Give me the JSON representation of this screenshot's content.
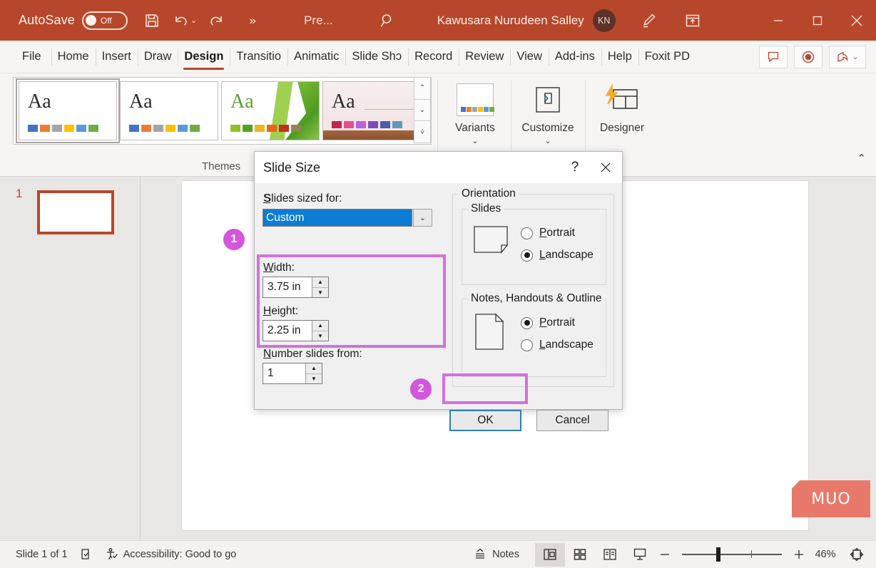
{
  "titlebar": {
    "autosave_label": "AutoSave",
    "autosave_state": "Off",
    "save_icon": "save-icon",
    "undo_icon": "undo-icon",
    "redo_icon": "redo-icon",
    "more_icon": "chevron-double-right-icon",
    "filename": "Pre...",
    "search_icon": "search-icon",
    "username": "Kawusara Nurudeen Salley",
    "avatar_initials": "KN",
    "pen_icon": "pen-draw-icon",
    "ribbon_display_icon": "ribbon-display-options-icon",
    "minimize": "minimize-icon",
    "maximize": "maximize-icon",
    "close": "close-icon",
    "bg_color": "#b7472a"
  },
  "tabs": [
    {
      "label": "File",
      "active": false
    },
    {
      "label": "Home",
      "active": false
    },
    {
      "label": "Insert",
      "active": false
    },
    {
      "label": "Draw",
      "active": false
    },
    {
      "label": "Design",
      "active": true
    },
    {
      "label": "Transitio",
      "active": false
    },
    {
      "label": "Animatic",
      "active": false
    },
    {
      "label": "Slide Shɔ",
      "active": false
    },
    {
      "label": "Record",
      "active": false
    },
    {
      "label": "Review",
      "active": false
    },
    {
      "label": "View",
      "active": false
    },
    {
      "label": "Add-ins",
      "active": false
    },
    {
      "label": "Help",
      "active": false
    },
    {
      "label": "Foxit PD",
      "active": false
    }
  ],
  "tabbar_right": [
    {
      "name": "comments-button",
      "icon": "comment-icon"
    },
    {
      "name": "record-button",
      "icon": "record-circle-icon"
    },
    {
      "name": "share-button",
      "icon": "share-icon"
    }
  ],
  "ribbon": {
    "themes_group_label": "Themes",
    "themes": [
      {
        "name": "office-theme",
        "aa": "Aa",
        "selected": true,
        "swatches": [
          "#4472c4",
          "#ed7d31",
          "#a5a5a5",
          "#ffc000",
          "#5b9bd5",
          "#70ad47"
        ]
      },
      {
        "name": "office-theme-2",
        "aa": "Aa",
        "selected": false,
        "swatches": [
          "#4472c4",
          "#ed7d31",
          "#a5a5a5",
          "#ffc000",
          "#5b9bd5",
          "#70ad47"
        ]
      },
      {
        "name": "facet-theme",
        "aa": "Aa",
        "selected": false,
        "swatches": [
          "#90c226",
          "#54a021",
          "#e6b91e",
          "#e76618",
          "#c42f1a",
          "#918655"
        ]
      },
      {
        "name": "wisp-theme",
        "aa": "Aa",
        "selected": false,
        "swatches": [
          "#c0264a",
          "#e0518e",
          "#b861d9",
          "#7c4bb5",
          "#4a5db0",
          "#5f9ab5"
        ]
      }
    ],
    "gallery_scroll": [
      "scroll-up-icon",
      "scroll-down-icon",
      "more-themes-icon"
    ],
    "variants": {
      "label": "Variants",
      "caret": "chevron-down-icon"
    },
    "customize": {
      "label": "Customize",
      "caret": "chevron-down-icon"
    },
    "designer": {
      "label": "Designer"
    },
    "collapse_icon": "chevron-up-icon"
  },
  "thumbnail_pane": {
    "slide_number": "1"
  },
  "watermark": {
    "text": "MUO",
    "color": "#e8796a"
  },
  "dialog": {
    "title": "Slide Size",
    "help_icon": "help-question-icon",
    "close_icon": "close-icon",
    "sized_for_label": "Slides sized for:",
    "sized_for_value": "Custom",
    "dropdown_icon": "chevron-down-icon",
    "width_label": "Width:",
    "width_value": "3.75 in",
    "height_label": "Height:",
    "height_value": "2.25 in",
    "number_from_label": "Number slides from:",
    "number_from_value": "1",
    "orientation_label": "Orientation",
    "slides_group_label": "Slides",
    "slides_portrait": "Portrait",
    "slides_landscape": "Landscape",
    "slides_selected": "Landscape",
    "notes_group_label": "Notes, Handouts & Outline",
    "notes_portrait": "Portrait",
    "notes_landscape": "Landscape",
    "notes_selected": "Portrait",
    "ok_label": "OK",
    "cancel_label": "Cancel",
    "highlight_color": "#d46fe0"
  },
  "annotations": [
    {
      "number": "1",
      "target": "width-height-fields"
    },
    {
      "number": "2",
      "target": "ok-button"
    }
  ],
  "statusbar": {
    "slide_count": "Slide 1 of 1",
    "language_icon": "spellcheck-icon",
    "accessibility_icon": "accessibility-icon",
    "accessibility_text": "Accessibility: Good to go",
    "notes_icon": "notes-icon",
    "notes_label": "Notes",
    "views": [
      {
        "name": "normal-view-button",
        "icon": "normal-view-icon",
        "active": true
      },
      {
        "name": "slide-sorter-button",
        "icon": "grid-view-icon",
        "active": false
      },
      {
        "name": "reading-view-button",
        "icon": "reading-view-icon",
        "active": false
      },
      {
        "name": "slideshow-button",
        "icon": "slideshow-icon",
        "active": false
      }
    ],
    "zoom_out_icon": "minus-icon",
    "zoom_in_icon": "plus-icon",
    "zoom_level": "46%",
    "fit_icon": "fit-to-window-icon"
  }
}
